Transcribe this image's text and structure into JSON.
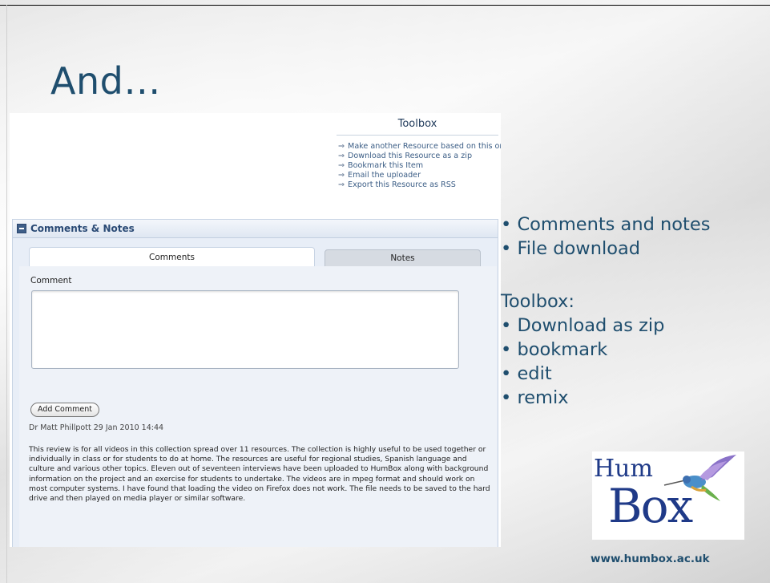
{
  "slide": {
    "title": "And…",
    "bullets": [
      "Comments and notes",
      "File download"
    ],
    "toolbox_heading": "Toolbox:",
    "toolbox_bullets": [
      "Download as zip",
      "bookmark",
      "edit",
      "remix"
    ],
    "logo_text_top": "Hum",
    "logo_text_bottom": "Box",
    "url": "www.humbox.ac.uk"
  },
  "toolbox": {
    "title": "Toolbox",
    "links": [
      "Make another Resource based on this one",
      "Download this Resource as a zip",
      "Bookmark this Item",
      "Email the uploader",
      "Export this Resource as RSS"
    ]
  },
  "comments_panel": {
    "title": "Comments & Notes",
    "tabs": [
      "Comments",
      "Notes"
    ],
    "comment_label": "Comment",
    "comment_value": "",
    "add_button": "Add Comment",
    "review_meta": "Dr Matt Phillpott 29 Jan 2010 14:44",
    "review_text": "This review is for all videos in this collection spread over 11 resources. The collection is highly useful to be used together or individually in class or for students to do at home. The resources are useful for regional studies, Spanish language and culture and various other topics. Eleven out of seventeen interviews have been uploaded to HumBox along with background information on the project and an exercise for students to undertake. The videos are in mpeg format and should work on most computer systems. I have found that loading the video on Firefox does not work. The file needs to be saved to the hard drive and then played on media player or similar software."
  },
  "icons": {
    "arrow": "right-arrow-icon",
    "collapse": "minus-box-icon",
    "bird": "hummingbird-icon"
  }
}
